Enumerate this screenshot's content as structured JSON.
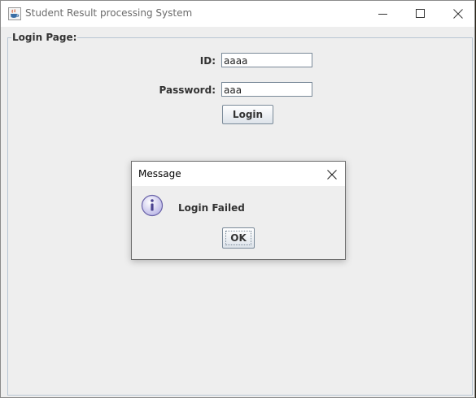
{
  "window": {
    "title": "Student Result processing System",
    "app_icon": "java-cup-icon",
    "controls": [
      "minimize-icon",
      "maximize-icon",
      "close-icon"
    ]
  },
  "login_panel": {
    "group_title": "Login Page:",
    "id_label": "ID:",
    "id_value": "aaaa",
    "password_label": "Password:",
    "password_value": "aaa",
    "login_button": "Login"
  },
  "dialog": {
    "title": "Message",
    "icon": "information-icon",
    "message": "Login Failed",
    "ok_button": "OK"
  }
}
